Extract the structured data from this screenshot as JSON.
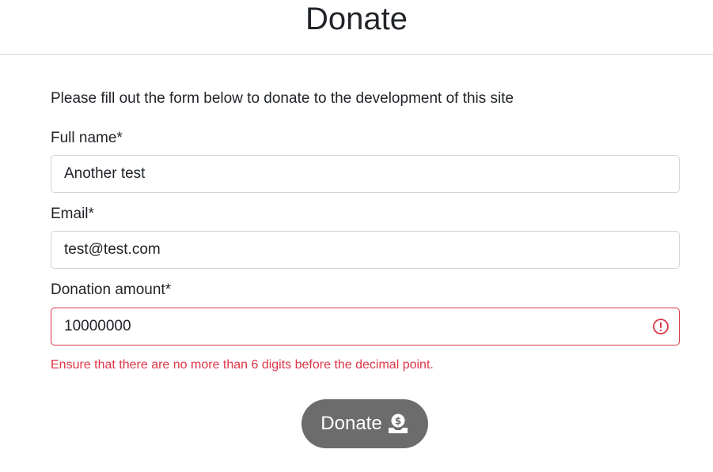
{
  "header": {
    "title": "Donate"
  },
  "form": {
    "intro": "Please fill out the form below to donate to the development of this site",
    "full_name": {
      "label": "Full name*",
      "value": "Another test"
    },
    "email": {
      "label": "Email*",
      "value": "test@test.com"
    },
    "amount": {
      "label": "Donation amount*",
      "value": "10000000",
      "error": "Ensure that there are no more than 6 digits before the decimal point."
    },
    "submit": {
      "label": "Donate",
      "icon": "hand-holding-dollar-icon"
    }
  },
  "colors": {
    "error": "#dc3545",
    "button_bg": "#6c6c6c",
    "divider": "#cfcfcf",
    "input_border": "#ced4da"
  }
}
